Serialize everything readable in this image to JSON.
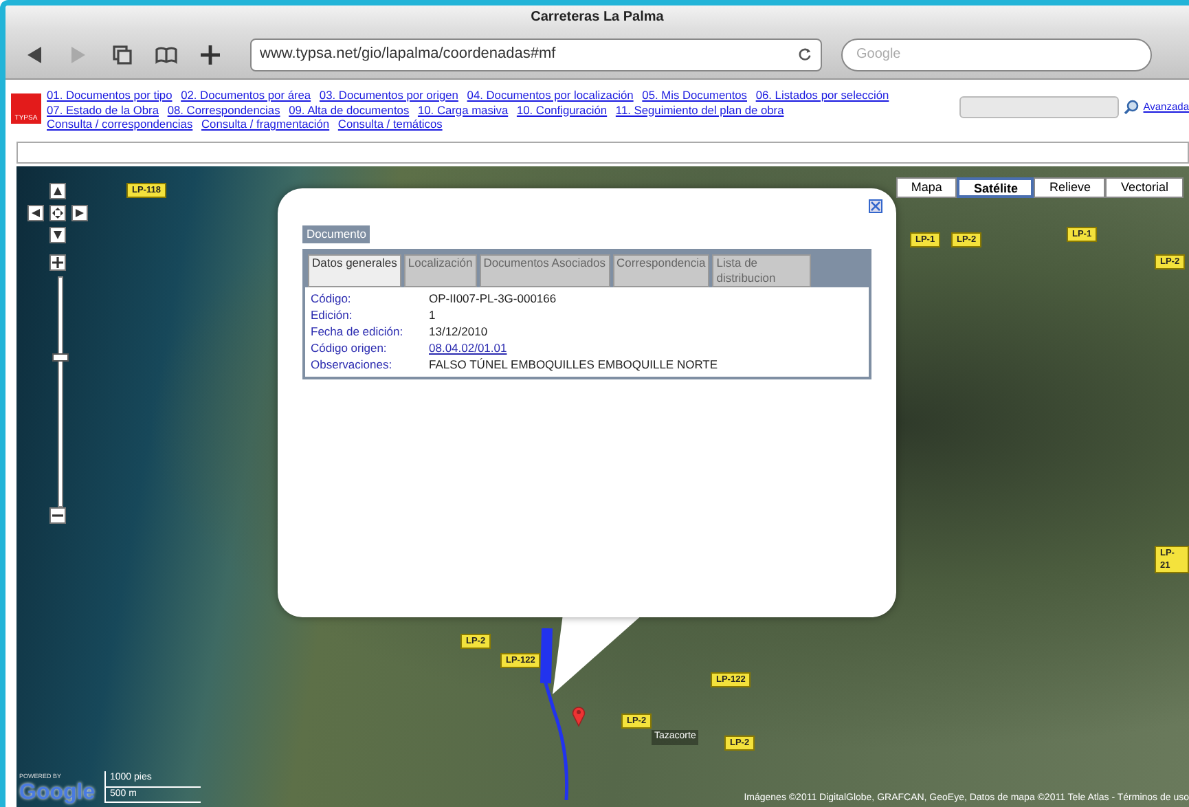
{
  "window": {
    "title": "Carreteras La Palma"
  },
  "toolbar": {
    "url": "www.typsa.net/gio/lapalma/coordenadas#mf",
    "search_placeholder": "Google"
  },
  "header": {
    "logo": "TYPSA",
    "nav_links": [
      "01. Documentos por tipo",
      "02. Documentos por área",
      "03. Documentos por origen",
      "04. Documentos por localización",
      "05. Mis Documentos",
      "06. Listados por selección",
      "07. Estado de la Obra",
      "08. Correspondencias",
      "09. Alta de documentos",
      "10. Carga masiva",
      "10. Configuración",
      "11. Seguimiento del plan de obra",
      "Consulta / correspondencias",
      "Consulta / fragmentación",
      "Consulta / temáticos"
    ],
    "advanced_link": "Avanzada"
  },
  "map": {
    "type_buttons": [
      {
        "label": "Mapa",
        "selected": false
      },
      {
        "label": "Satélite",
        "selected": true
      },
      {
        "label": "Relieve",
        "selected": false
      },
      {
        "label": "Vectorial",
        "selected": false
      }
    ],
    "zoom": {
      "level": 0.66
    },
    "road_labels": [
      "LP-118",
      "LP-1",
      "LP-2",
      "LP-1",
      "LP-2",
      "LP-2",
      "LP-122",
      "LP-122",
      "LP-2",
      "LP-2",
      "LP-21"
    ],
    "place_label": "Tazacorte",
    "popup": {
      "title": "Documento",
      "tabs": [
        {
          "label": "Datos generales",
          "selected": true
        },
        {
          "label": "Localización",
          "selected": false
        },
        {
          "label": "Documentos Asociados",
          "selected": false
        },
        {
          "label": "Correspondencia",
          "selected": false
        },
        {
          "label": "Lista de distribucion",
          "selected": false
        }
      ],
      "fields": [
        {
          "label": "Código:",
          "value": "OP-II007-PL-3G-000166",
          "kind": "text"
        },
        {
          "label": "Edición:",
          "value": "1",
          "kind": "text"
        },
        {
          "label": "Fecha de edición:",
          "value": "13/12/2010",
          "kind": "text"
        },
        {
          "label": "Código origen:",
          "value": "08.04.02/01.01",
          "kind": "link"
        },
        {
          "label": "Observaciones:",
          "value": "FALSO TÚNEL EMBOQUILLES EMBOQUILLE NORTE",
          "kind": "text"
        }
      ]
    },
    "powered_by": "POWERED BY",
    "google_logo": "Google",
    "scale": [
      "1000 pies",
      "500 m"
    ],
    "attribution": "Imágenes ©2011 DigitalGlobe, GRAFCAN, GeoEye, Datos de mapa ©2011 Tele Atlas - Términos de uso"
  }
}
